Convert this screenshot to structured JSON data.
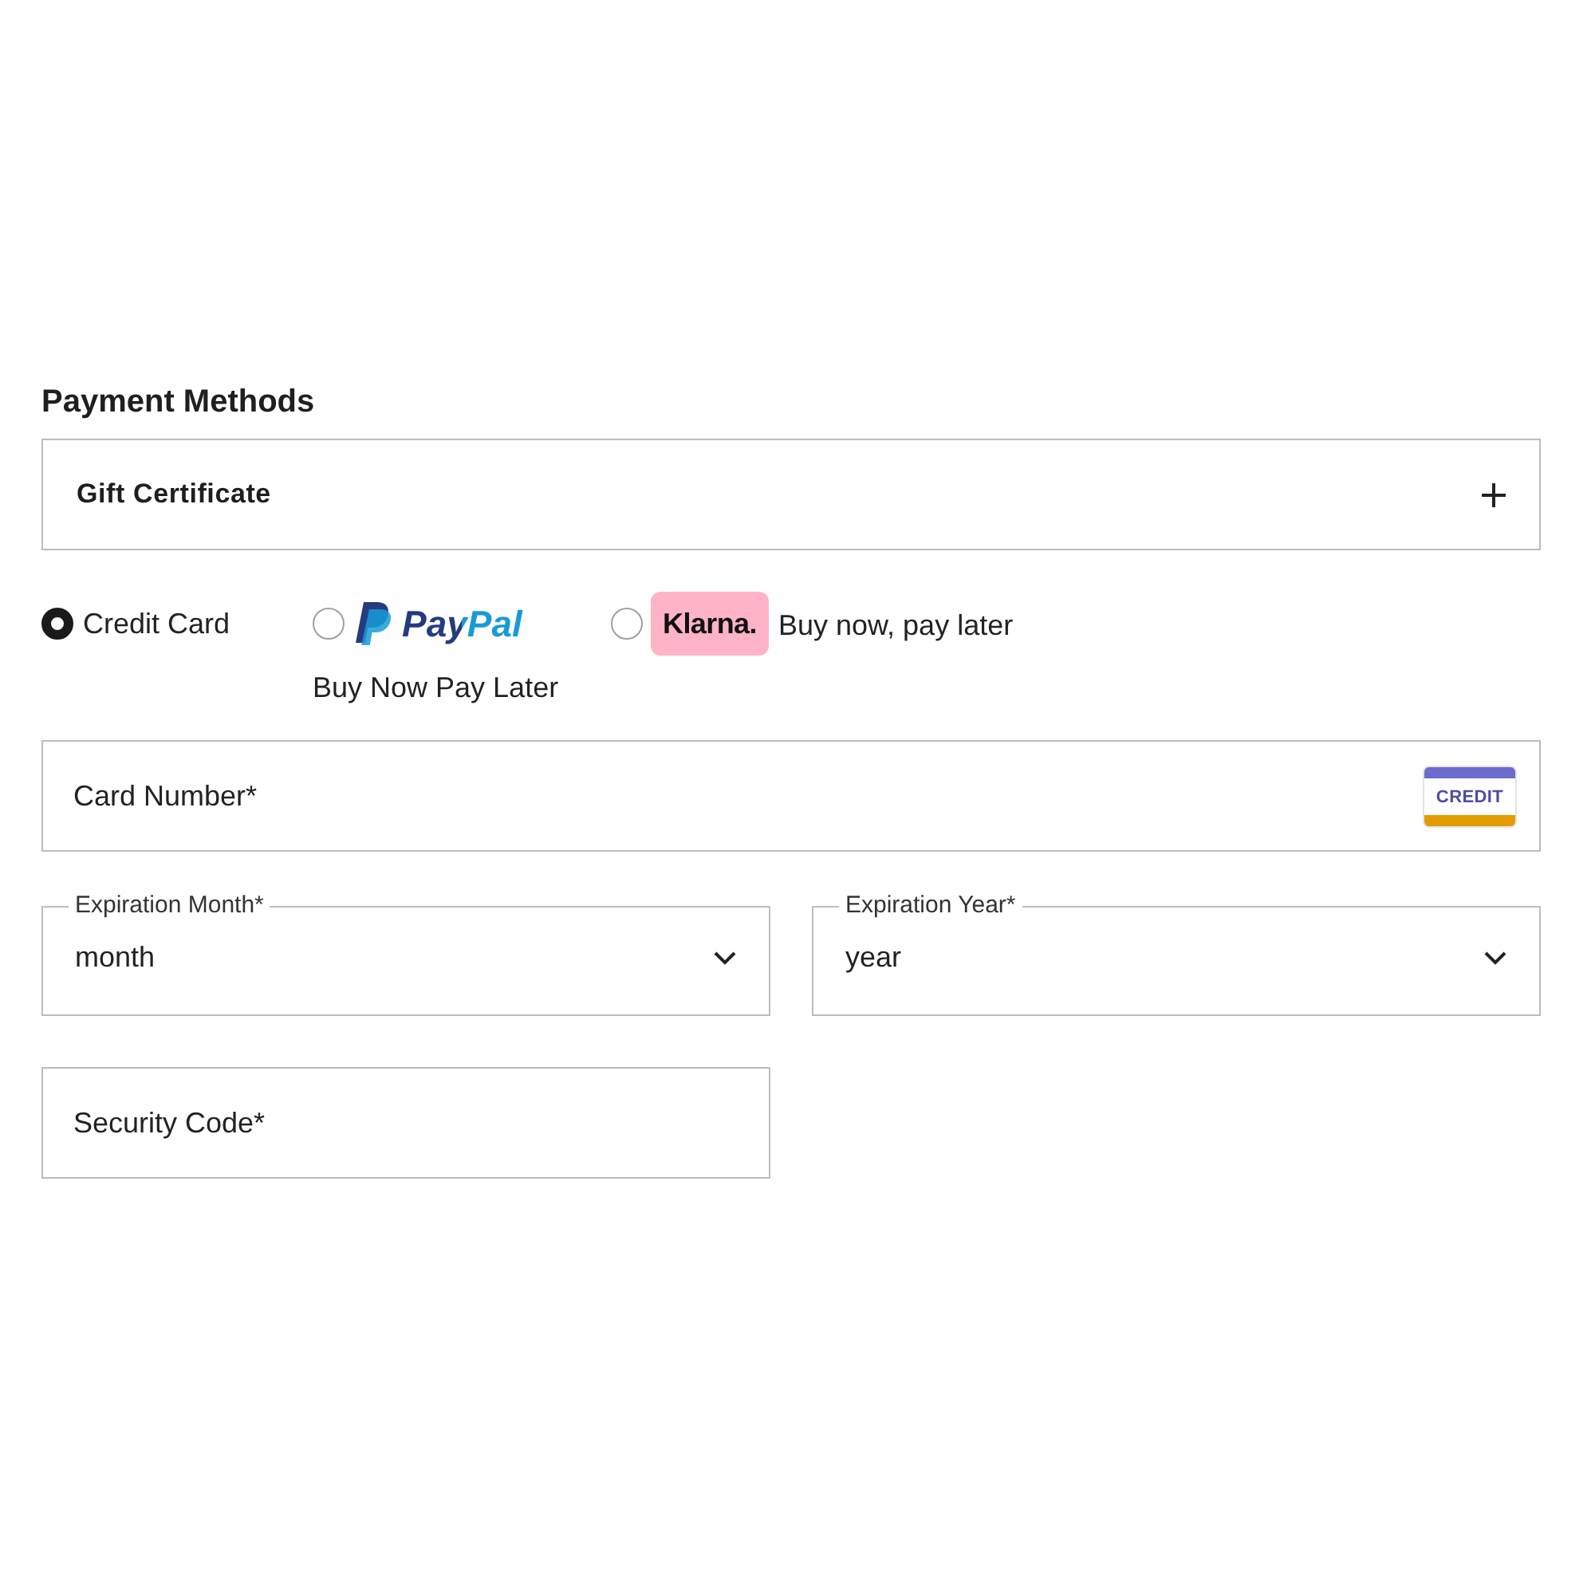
{
  "heading": "Payment Methods",
  "gift_certificate": {
    "label": "Gift Certificate",
    "expanded": false
  },
  "payment_options": [
    {
      "kind": "plain",
      "label": "Credit Card",
      "selected": true
    },
    {
      "kind": "paypal",
      "logo": "PayPal",
      "caption": "Buy Now Pay Later",
      "selected": false
    },
    {
      "kind": "klarna",
      "logo": "Klarna.",
      "caption": "Buy now, pay later",
      "selected": false
    }
  ],
  "card_number": {
    "placeholder": "Card Number*",
    "card_badge": "CREDIT"
  },
  "expiration": [
    {
      "label": "Expiration Month*",
      "value": "month"
    },
    {
      "label": "Expiration Year*",
      "value": "year"
    }
  ],
  "security_code": {
    "placeholder": "Security Code*"
  }
}
